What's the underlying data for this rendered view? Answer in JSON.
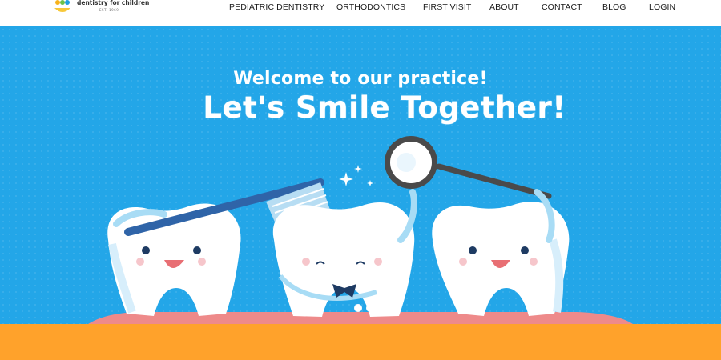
{
  "brand": {
    "name": "dentistry for children",
    "est": "EST. 1969",
    "colors": {
      "hero": "#23a6e8",
      "accent": "#ffa22b",
      "gum": "#ee8a8a",
      "brush": "#2f64a8"
    }
  },
  "nav": {
    "items": [
      {
        "label": "PEDIATRIC DENTISTRY"
      },
      {
        "label": "ORTHODONTICS"
      },
      {
        "label": "FIRST VISIT"
      },
      {
        "label": "ABOUT"
      },
      {
        "label": "CONTACT"
      },
      {
        "label": "BLOG"
      },
      {
        "label": "LOGIN"
      }
    ]
  },
  "hero": {
    "welcome": "Welcome to our practice!",
    "tagline": "Let's Smile Together!",
    "illustration": {
      "characters": [
        "tooth-with-toothbrush-icon",
        "tooth-with-bowtie-icon",
        "tooth-with-dental-mirror-icon"
      ],
      "decor": [
        "sparkle-icon"
      ]
    }
  }
}
